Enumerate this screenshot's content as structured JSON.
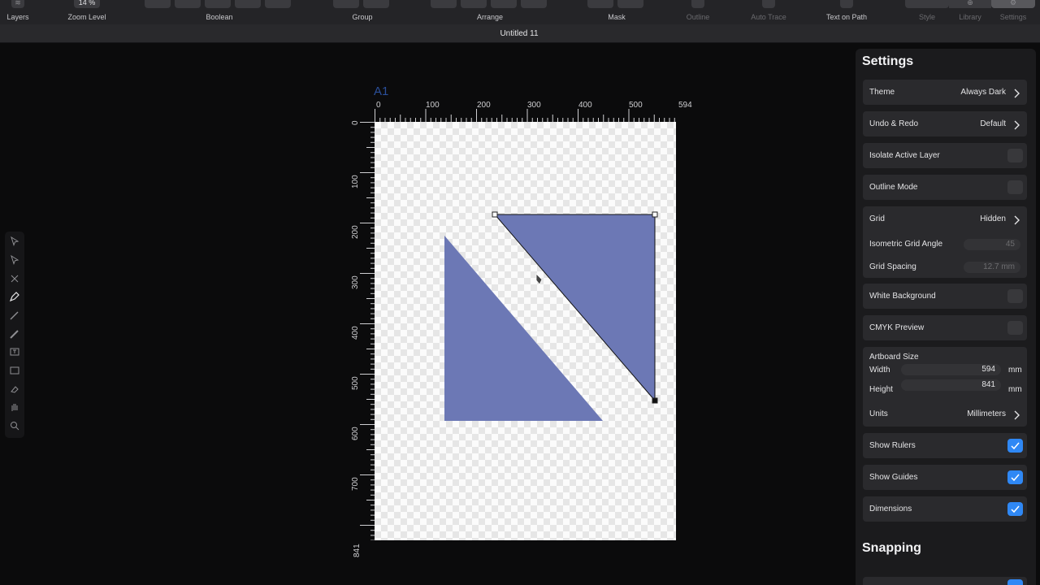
{
  "toolbar": {
    "layers_label": "Layers",
    "zoom_value": "14 %",
    "zoom_label": "Zoom Level",
    "boolean_label": "Boolean",
    "group_label": "Group",
    "arrange_label": "Arrange",
    "mask_label": "Mask",
    "outline_label": "Outline",
    "auto_trace_label": "Auto Trace",
    "text_on_path_label": "Text on Path",
    "style_label": "Style",
    "library_label": "Library",
    "settings_label": "Settings"
  },
  "document": {
    "title": "Untitled 11"
  },
  "canvas": {
    "artboard_name": "A1",
    "hruler_ticks": [
      "0",
      "100",
      "200",
      "300",
      "400",
      "500",
      "594"
    ],
    "vruler_ticks": [
      "0",
      "100",
      "200",
      "300",
      "400",
      "500",
      "600",
      "700",
      "841"
    ],
    "shape_color": "#6c78b5"
  },
  "settings": {
    "title": "Settings",
    "theme_label": "Theme",
    "theme_value": "Always Dark",
    "undo_label": "Undo & Redo",
    "undo_value": "Default",
    "isolate_label": "Isolate Active Layer",
    "outline_mode_label": "Outline Mode",
    "grid_label": "Grid",
    "grid_value": "Hidden",
    "iso_angle_label": "Isometric Grid Angle",
    "iso_angle_value": "45",
    "grid_spacing_label": "Grid Spacing",
    "grid_spacing_value": "12.7 mm",
    "white_bg_label": "White Background",
    "cmyk_label": "CMYK Preview",
    "artboard_size_label": "Artboard Size",
    "width_label": "Width",
    "width_value": "594",
    "height_label": "Height",
    "height_value": "841",
    "unit_mm": "mm",
    "units_label": "Units",
    "units_value": "Millimeters",
    "show_rulers_label": "Show Rulers",
    "show_guides_label": "Show Guides",
    "dimensions_label": "Dimensions",
    "accent_color": "#2f88f5"
  },
  "snapping": {
    "title": "Snapping"
  }
}
